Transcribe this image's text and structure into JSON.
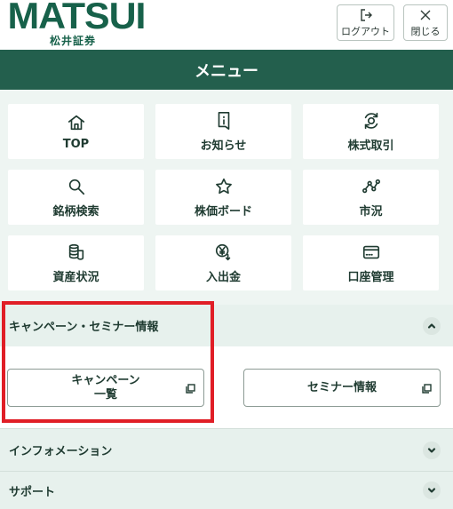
{
  "header": {
    "logo_text": "MATSUI",
    "logo_sub": "松井証券",
    "logout_label": "ログアウト",
    "close_label": "閉じる"
  },
  "title": "メニュー",
  "tiles": [
    {
      "label": "TOP",
      "icon": "home-icon"
    },
    {
      "label": "お知らせ",
      "icon": "notice-icon"
    },
    {
      "label": "株式取引",
      "icon": "stock-trade-icon"
    },
    {
      "label": "銘柄検索",
      "icon": "search-icon"
    },
    {
      "label": "株価ボード",
      "icon": "star-icon"
    },
    {
      "label": "市況",
      "icon": "market-chart-icon"
    },
    {
      "label": "資産状況",
      "icon": "coins-icon"
    },
    {
      "label": "入出金",
      "icon": "yen-transfer-icon"
    },
    {
      "label": "口座管理",
      "icon": "card-icon"
    }
  ],
  "sections": {
    "campaign": {
      "label": "キャンペーン・セミナー情報",
      "expanded": true,
      "buttons": {
        "campaign_line1": "キャンペーン",
        "campaign_line2": "一覧",
        "seminar": "セミナー情報"
      }
    },
    "information": {
      "label": "インフォメーション",
      "expanded": false
    },
    "support": {
      "label": "サポート",
      "expanded": false
    }
  },
  "colors": {
    "brand_green": "#17614a",
    "title_bar": "#235f4d",
    "highlight_red": "#e01e26"
  }
}
